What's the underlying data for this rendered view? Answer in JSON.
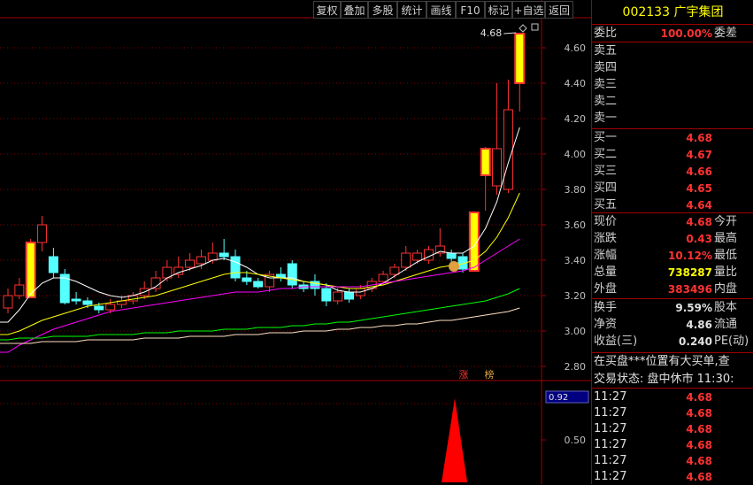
{
  "toolbar": {
    "buttons": [
      "复权",
      "叠加",
      "多股",
      "统计",
      "画线",
      "F10",
      "标记",
      "+自选",
      "返回"
    ]
  },
  "chart_data": {
    "type": "candlestick",
    "price_axis_ticks": [
      "4.60",
      "4.40",
      "4.20",
      "4.00",
      "3.80",
      "3.60",
      "3.40",
      "3.20",
      "3.00",
      "2.80"
    ],
    "ylim": [
      2.72,
      4.77
    ],
    "high_label": "4.68",
    "candles": [
      {
        "o": 3.13,
        "c": 3.2,
        "h": 3.24,
        "l": 3.1
      },
      {
        "o": 3.2,
        "c": 3.26,
        "h": 3.3,
        "l": 3.18
      },
      {
        "o": 3.19,
        "c": 3.5,
        "h": 3.52,
        "l": 3.19
      },
      {
        "o": 3.5,
        "c": 3.6,
        "h": 3.65,
        "l": 3.45
      },
      {
        "o": 3.42,
        "c": 3.33,
        "h": 3.47,
        "l": 3.3
      },
      {
        "o": 3.32,
        "c": 3.16,
        "h": 3.35,
        "l": 3.15
      },
      {
        "o": 3.18,
        "c": 3.17,
        "h": 3.22,
        "l": 3.15
      },
      {
        "o": 3.17,
        "c": 3.15,
        "h": 3.19,
        "l": 3.13
      },
      {
        "o": 3.14,
        "c": 3.12,
        "h": 3.16,
        "l": 3.1
      },
      {
        "o": 3.12,
        "c": 3.15,
        "h": 3.18,
        "l": 3.1
      },
      {
        "o": 3.15,
        "c": 3.17,
        "h": 3.2,
        "l": 3.13
      },
      {
        "o": 3.17,
        "c": 3.2,
        "h": 3.22,
        "l": 3.15
      },
      {
        "o": 3.2,
        "c": 3.24,
        "h": 3.28,
        "l": 3.18
      },
      {
        "o": 3.24,
        "c": 3.3,
        "h": 3.34,
        "l": 3.22
      },
      {
        "o": 3.3,
        "c": 3.36,
        "h": 3.4,
        "l": 3.28
      },
      {
        "o": 3.32,
        "c": 3.36,
        "h": 3.42,
        "l": 3.3
      },
      {
        "o": 3.36,
        "c": 3.4,
        "h": 3.44,
        "l": 3.34
      },
      {
        "o": 3.38,
        "c": 3.42,
        "h": 3.46,
        "l": 3.35
      },
      {
        "o": 3.4,
        "c": 3.44,
        "h": 3.5,
        "l": 3.38
      },
      {
        "o": 3.44,
        "c": 3.42,
        "h": 3.52,
        "l": 3.4
      },
      {
        "o": 3.42,
        "c": 3.3,
        "h": 3.46,
        "l": 3.28
      },
      {
        "o": 3.3,
        "c": 3.28,
        "h": 3.34,
        "l": 3.26
      },
      {
        "o": 3.28,
        "c": 3.25,
        "h": 3.3,
        "l": 3.24
      },
      {
        "o": 3.25,
        "c": 3.32,
        "h": 3.34,
        "l": 3.22
      },
      {
        "o": 3.32,
        "c": 3.3,
        "h": 3.36,
        "l": 3.28
      },
      {
        "o": 3.38,
        "c": 3.26,
        "h": 3.4,
        "l": 3.24
      },
      {
        "o": 3.26,
        "c": 3.24,
        "h": 3.28,
        "l": 3.22
      },
      {
        "o": 3.28,
        "c": 3.24,
        "h": 3.32,
        "l": 3.2
      },
      {
        "o": 3.24,
        "c": 3.17,
        "h": 3.27,
        "l": 3.14
      },
      {
        "o": 3.17,
        "c": 3.22,
        "h": 3.25,
        "l": 3.15
      },
      {
        "o": 3.22,
        "c": 3.18,
        "h": 3.24,
        "l": 3.16
      },
      {
        "o": 3.2,
        "c": 3.24,
        "h": 3.26,
        "l": 3.18
      },
      {
        "o": 3.24,
        "c": 3.28,
        "h": 3.3,
        "l": 3.22
      },
      {
        "o": 3.28,
        "c": 3.32,
        "h": 3.34,
        "l": 3.26
      },
      {
        "o": 3.32,
        "c": 3.36,
        "h": 3.38,
        "l": 3.3
      },
      {
        "o": 3.36,
        "c": 3.44,
        "h": 3.48,
        "l": 3.34
      },
      {
        "o": 3.4,
        "c": 3.44,
        "h": 3.46,
        "l": 3.38
      },
      {
        "o": 3.4,
        "c": 3.46,
        "h": 3.48,
        "l": 3.38
      },
      {
        "o": 3.44,
        "c": 3.48,
        "h": 3.58,
        "l": 3.42
      },
      {
        "o": 3.44,
        "c": 3.41,
        "h": 3.46,
        "l": 3.38
      },
      {
        "o": 3.42,
        "c": 3.35,
        "h": 3.44,
        "l": 3.33
      },
      {
        "o": 3.34,
        "c": 3.67,
        "h": 3.67,
        "l": 3.34
      },
      {
        "o": 3.88,
        "c": 4.03,
        "h": 4.04,
        "l": 3.68
      },
      {
        "o": 3.82,
        "c": 4.03,
        "h": 4.4,
        "l": 3.77
      },
      {
        "o": 3.8,
        "c": 4.25,
        "h": 4.42,
        "l": 3.78
      },
      {
        "o": 4.4,
        "c": 4.68,
        "h": 4.68,
        "l": 4.24
      }
    ],
    "ma_lines": [
      {
        "color": "#ffffff",
        "values": [
          3.05,
          3.12,
          3.21,
          3.27,
          3.3,
          3.3,
          3.28,
          3.25,
          3.22,
          3.2,
          3.19,
          3.2,
          3.22,
          3.25,
          3.3,
          3.33,
          3.35,
          3.37,
          3.4,
          3.41,
          3.39,
          3.36,
          3.32,
          3.3,
          3.3,
          3.3,
          3.28,
          3.27,
          3.26,
          3.23,
          3.22,
          3.22,
          3.24,
          3.27,
          3.31,
          3.35,
          3.39,
          3.42,
          3.45,
          3.44,
          3.44,
          3.48,
          3.58,
          3.73,
          3.95,
          4.15
        ]
      },
      {
        "color": "#ffff00",
        "values": [
          2.98,
          3.0,
          3.03,
          3.06,
          3.08,
          3.1,
          3.12,
          3.14,
          3.15,
          3.16,
          3.17,
          3.18,
          3.19,
          3.2,
          3.22,
          3.24,
          3.26,
          3.28,
          3.3,
          3.32,
          3.33,
          3.33,
          3.32,
          3.31,
          3.3,
          3.29,
          3.28,
          3.27,
          3.26,
          3.25,
          3.24,
          3.24,
          3.25,
          3.26,
          3.28,
          3.3,
          3.32,
          3.34,
          3.36,
          3.37,
          3.38,
          3.4,
          3.45,
          3.53,
          3.64,
          3.78
        ]
      },
      {
        "color": "#ff00ff",
        "values": [
          2.88,
          2.92,
          2.95,
          2.98,
          3.01,
          3.03,
          3.05,
          3.07,
          3.09,
          3.11,
          3.12,
          3.13,
          3.14,
          3.15,
          3.16,
          3.17,
          3.18,
          3.19,
          3.2,
          3.21,
          3.22,
          3.22,
          3.22,
          3.23,
          3.24,
          3.24,
          3.25,
          3.25,
          3.25,
          3.25,
          3.25,
          3.25,
          3.26,
          3.27,
          3.28,
          3.29,
          3.3,
          3.31,
          3.32,
          3.33,
          3.34,
          3.36,
          3.4,
          3.44,
          3.48,
          3.52
        ]
      },
      {
        "color": "#00ff00",
        "values": [
          2.95,
          2.96,
          2.96,
          2.96,
          2.97,
          2.97,
          2.97,
          2.97,
          2.98,
          2.98,
          2.98,
          2.98,
          2.99,
          2.99,
          2.99,
          3.0,
          3.0,
          3.0,
          3.0,
          3.01,
          3.01,
          3.01,
          3.02,
          3.02,
          3.02,
          3.03,
          3.03,
          3.04,
          3.04,
          3.05,
          3.05,
          3.06,
          3.07,
          3.08,
          3.09,
          3.1,
          3.11,
          3.12,
          3.13,
          3.14,
          3.15,
          3.16,
          3.17,
          3.19,
          3.21,
          3.24
        ]
      },
      {
        "color": "#ffe0c0",
        "values": [
          2.93,
          2.93,
          2.93,
          2.94,
          2.94,
          2.94,
          2.94,
          2.95,
          2.95,
          2.95,
          2.95,
          2.95,
          2.96,
          2.96,
          2.96,
          2.96,
          2.97,
          2.97,
          2.97,
          2.97,
          2.98,
          2.98,
          2.98,
          2.99,
          2.99,
          2.99,
          3.0,
          3.0,
          3.0,
          3.01,
          3.01,
          3.02,
          3.02,
          3.03,
          3.03,
          3.04,
          3.04,
          3.05,
          3.06,
          3.06,
          3.07,
          3.08,
          3.09,
          3.1,
          3.11,
          3.13
        ]
      }
    ],
    "markers": {
      "limit_up_1": "涨",
      "limit_up_2": "榜"
    },
    "indicator": {
      "current": "0.92",
      "tick": "0.50",
      "signal": [
        0,
        0,
        0,
        0,
        0,
        0,
        0,
        0,
        0,
        0,
        0,
        0,
        0,
        0,
        0,
        0,
        0,
        0,
        0,
        0,
        0,
        0,
        0,
        0,
        0,
        0,
        0,
        0,
        0,
        0,
        0,
        0,
        0,
        0,
        0,
        0,
        0,
        0,
        0,
        0,
        0,
        0,
        0,
        0,
        0,
        0
      ]
    }
  },
  "quote": {
    "code": "002133",
    "name": "广宇集团",
    "wei_bi_label": "委比",
    "wei_bi": "100.00%",
    "wei_cha_label": "委差",
    "sell": [
      {
        "label": "卖五",
        "price": "",
        "vol": ""
      },
      {
        "label": "卖四",
        "price": "",
        "vol": ""
      },
      {
        "label": "卖三",
        "price": "",
        "vol": ""
      },
      {
        "label": "卖二",
        "price": "",
        "vol": ""
      },
      {
        "label": "卖一",
        "price": "",
        "vol": ""
      }
    ],
    "buy": [
      {
        "label": "买一",
        "price": "4.68"
      },
      {
        "label": "买二",
        "price": "4.67"
      },
      {
        "label": "买三",
        "price": "4.66"
      },
      {
        "label": "买四",
        "price": "4.65"
      },
      {
        "label": "买五",
        "price": "4.64"
      }
    ],
    "stats": [
      {
        "l": "现价",
        "v": "4.68",
        "vc": "red",
        "l2": "今开"
      },
      {
        "l": "涨跌",
        "v": "0.43",
        "vc": "red",
        "l2": "最高"
      },
      {
        "l": "涨幅",
        "v": "10.12%",
        "vc": "red",
        "l2": "最低"
      },
      {
        "l": "总量",
        "v": "738287",
        "vc": "yel",
        "l2": "量比"
      },
      {
        "l": "外盘",
        "v": "383496",
        "vc": "red",
        "l2": "内盘"
      }
    ],
    "stats2": [
      {
        "l": "换手",
        "v": "9.59%",
        "vc": "wht",
        "l2": "股本"
      },
      {
        "l": "净资",
        "v": "4.86",
        "vc": "wht",
        "l2": "流通"
      },
      {
        "l": "收益(三)",
        "v": "0.240",
        "vc": "wht",
        "l2": "PE(动)"
      }
    ],
    "notice": "在买盘***位置有大买单,查",
    "status": "交易状态: 盘中休市 11:30:",
    "ticks": [
      {
        "time": "11:27",
        "price": "4.68"
      },
      {
        "time": "11:27",
        "price": "4.68"
      },
      {
        "time": "11:27",
        "price": "4.68"
      },
      {
        "time": "11:27",
        "price": "4.68"
      },
      {
        "time": "11:27",
        "price": "4.68"
      },
      {
        "time": "11:27",
        "price": "4.68"
      }
    ]
  }
}
